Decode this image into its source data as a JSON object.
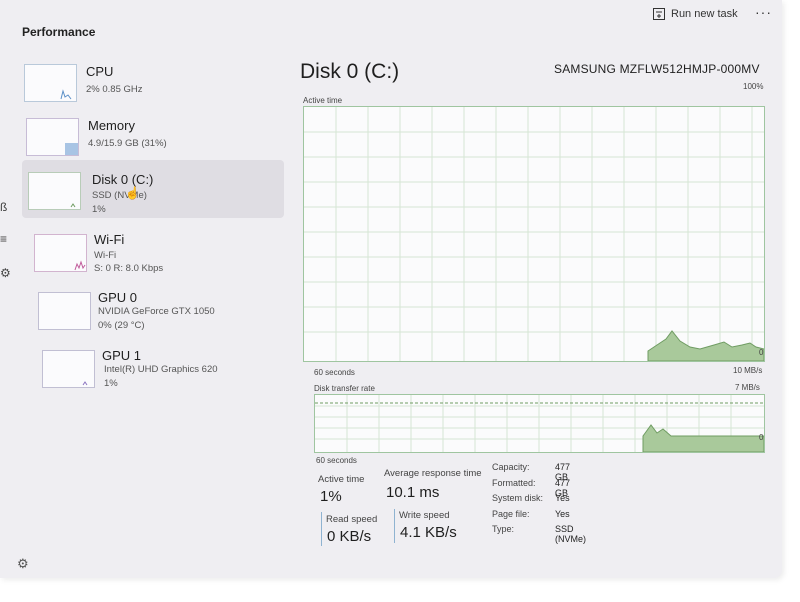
{
  "header": {
    "title": "Performance",
    "run_new_task_label": "Run new task",
    "more_label": "···"
  },
  "devices": [
    {
      "name": "CPU",
      "line1": "2% 0.85 GHz",
      "line2": ""
    },
    {
      "name": "Memory",
      "line1": "4.9/15.9 GB (31%)",
      "line2": ""
    },
    {
      "name": "Disk 0 (C:)",
      "line1": "SSD (NVMe)",
      "line2": "1%"
    },
    {
      "name": "Wi-Fi",
      "line1": "Wi-Fi",
      "line2": "S: 0 R: 8.0 Kbps"
    },
    {
      "name": "GPU 0",
      "line1": "NVIDIA GeForce GTX 1050",
      "line2": "0% (29 °C)"
    },
    {
      "name": "GPU 1",
      "line1": "Intel(R) UHD Graphics 620",
      "line2": "1%"
    }
  ],
  "main": {
    "title": "Disk 0 (C:)",
    "model": "SAMSUNG MZFLW512HMJP-000MV",
    "graph1": {
      "label": "Active time",
      "max": "100%",
      "time": "60 seconds",
      "min": "0"
    },
    "graph2": {
      "label": "Disk transfer rate",
      "max": "10 MB/s",
      "mid": "7 MB/s",
      "time": "60 seconds",
      "min": "0"
    }
  },
  "stats": {
    "active_time_label": "Active time",
    "active_time_value": "1%",
    "avg_response_label": "Average response time",
    "avg_response_value": "10.1 ms",
    "read_speed_label": "Read speed",
    "read_speed_value": "0 KB/s",
    "write_speed_label": "Write speed",
    "write_speed_value": "4.1 KB/s"
  },
  "properties": [
    {
      "key": "Capacity:",
      "value": "477 GB"
    },
    {
      "key": "Formatted:",
      "value": "477 GB"
    },
    {
      "key": "System disk:",
      "value": "Yes"
    },
    {
      "key": "Page file:",
      "value": "Yes"
    },
    {
      "key": "Type:",
      "value": "SSD (NVMe)"
    }
  ],
  "colors": {
    "accent_green": "#7aa76c",
    "grid_green": "#c6ddc4",
    "selected_bg": "#dfdde3"
  }
}
